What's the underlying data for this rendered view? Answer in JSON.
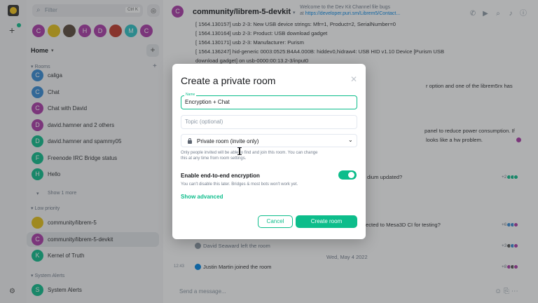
{
  "search": {
    "placeholder": "Filter",
    "shortcut": "Ctrl K"
  },
  "spaces": [
    {
      "letter": "C",
      "color": "#ac3ba8"
    },
    {
      "letter": "",
      "color": "#e6c117",
      "icon": "banana-icon"
    },
    {
      "letter": "",
      "color": "#5a4a3a",
      "icon": "person-photo"
    },
    {
      "letter": "H",
      "color": "#ac3ba8"
    },
    {
      "letter": "D",
      "color": "#ac3ba8"
    },
    {
      "letter": "",
      "color": "#c0392b",
      "icon": "group-photo"
    },
    {
      "letter": "M",
      "color": "#2dc2c5"
    },
    {
      "letter": "C",
      "color": "#ac3ba8"
    }
  ],
  "home": {
    "label": "Home"
  },
  "sections": {
    "rooms": "Rooms",
    "low_priority": "Low priority",
    "system_alerts": "System Alerts"
  },
  "rooms": [
    {
      "letter": "C",
      "color": "#368bd6",
      "name": "caliga"
    },
    {
      "letter": "C",
      "color": "#368bd6",
      "name": "Chat"
    },
    {
      "letter": "C",
      "color": "#ac3ba8",
      "name": "Chat with David"
    },
    {
      "letter": "D",
      "color": "#ac3ba8",
      "name": "david.hamner and 2 others"
    },
    {
      "letter": "D",
      "color": "#0dbd8b",
      "name": "david.hamner and spammy05"
    },
    {
      "letter": "F",
      "color": "#0dbd8b",
      "name": "Freenode IRC Bridge status"
    },
    {
      "letter": "H",
      "color": "#0dbd8b",
      "name": "Hello"
    }
  ],
  "show_more": "Show 1 more",
  "low_priority_rooms": [
    {
      "letter": "",
      "color": "#e6c117",
      "name": "community/librem-5"
    },
    {
      "letter": "C",
      "color": "#ac3ba8",
      "name": "community/librem-5-devkit"
    },
    {
      "letter": "K",
      "color": "#0dbd8b",
      "name": "Kernel of Truth"
    }
  ],
  "system_alert_rooms": [
    {
      "letter": "S",
      "color": "#0dbd8b",
      "name": "System Alerts"
    }
  ],
  "header": {
    "room_letter": "C",
    "room_name": "community/librem-5-devkit",
    "topic_line1": "Welcome to the Dev Kit Channel file bugs",
    "topic_line2_prefix": "at ",
    "topic_link": "https://developer.puri.sm/Librem5/Contact..."
  },
  "timeline": {
    "log_lines": [
      "[ 1564.130157] usb 2-3: New USB device strings: Mfr=1, Product=2, SerialNumber=0",
      "[ 1564.130164] usb 2-3: Product: USB download gadget",
      "[ 1564.130171] usb 2-3: Manufacturer: Purism",
      "[ 1564.136247] hid-generic 0003:0525:B4A4.000B: hiddev0,hidraw4: USB HID v1.10 Device [Purism USB",
      "download gadget] on usb-0000:00:13.2-3/input0"
    ],
    "frag1": "r option and one of the librem5rx has",
    "frag2": "panel to reduce power consumption. If",
    "frag3": "looks like a hw problem.",
    "frag4": "dium updated?",
    "frag5": "ected to Mesa3D CI for testing?",
    "event1": "David Seaward left the room",
    "date_sep": "Wed, May 4 2022",
    "time": "12:43",
    "event2": "Justin Martin joined the room",
    "rr1": "+2",
    "rr2": "+6",
    "rr3": "+3",
    "rr4": "+8"
  },
  "composer": {
    "placeholder": "Send a message..."
  },
  "dialog": {
    "title": "Create a private room",
    "name_label": "Name",
    "name_value": "Encryption + Chat",
    "topic_placeholder": "Topic (optional)",
    "visibility": "Private room (invite only)",
    "visibility_hint": "Only people invited will be able to find and join this room. You can change this at any time from room settings.",
    "e2e_label": "Enable end-to-end encryption",
    "e2e_enabled": true,
    "e2e_hint": "You can't disable this later. Bridges & most bots won't work yet.",
    "advanced": "Show advanced",
    "cancel": "Cancel",
    "create": "Create room"
  },
  "colors": {
    "accent": "#0dbd8b",
    "link": "#0086e6"
  }
}
